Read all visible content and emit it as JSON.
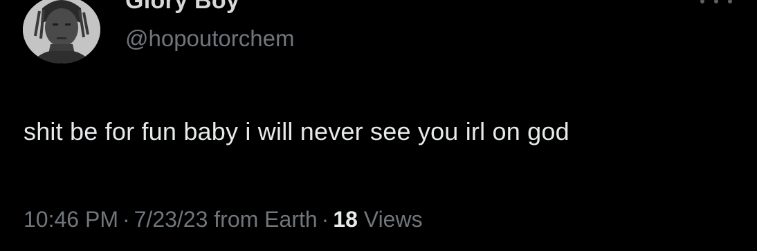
{
  "tweet": {
    "author": {
      "display_name": "Glory Boy",
      "handle": "@hopoutorchem",
      "avatar_icon": "profile-photo"
    },
    "more_icon": "more-horizontal-icon",
    "text": "shit be for fun baby i will never see you irl on god",
    "meta": {
      "time": "10:46 PM",
      "separator": "·",
      "date": "7/23/23",
      "source": "from Earth",
      "views_count": "18",
      "views_label": "Views"
    }
  },
  "colors": {
    "background": "#000000",
    "primary_text": "#e7e9ea",
    "secondary_text": "#71767b"
  }
}
